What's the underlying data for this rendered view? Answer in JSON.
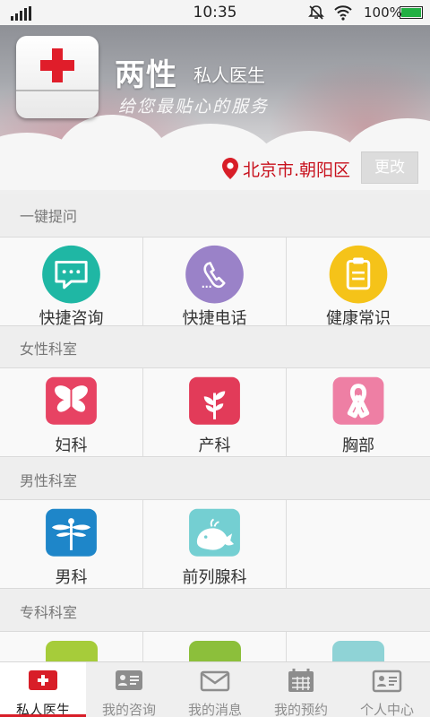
{
  "status_bar": {
    "time": "10:35",
    "battery": "100%",
    "icons": [
      "signal-icon",
      "mute-icon",
      "wifi-icon",
      "battery-icon"
    ]
  },
  "header": {
    "title": "两性",
    "subtitle": "私人医生",
    "slogan": "给您最贴心的服务",
    "location": "北京市.朝阳区",
    "change_label": "更改"
  },
  "sections": [
    {
      "title": "一键提问",
      "items": [
        {
          "label": "快捷咨询",
          "icon": "chat-bubble-icon",
          "color": "#1fb7a4"
        },
        {
          "label": "快捷电话",
          "icon": "phone-icon",
          "color": "#9a82c8"
        },
        {
          "label": "健康常识",
          "icon": "clipboard-icon",
          "color": "#f5c319"
        }
      ]
    },
    {
      "title": "女性科室",
      "items": [
        {
          "label": "妇科",
          "icon": "butterfly-icon",
          "color": "#e74363"
        },
        {
          "label": "产科",
          "icon": "sprout-icon",
          "color": "#e23b59"
        },
        {
          "label": "胸部",
          "icon": "pink-ribbon-icon",
          "color": "#ee7fa4"
        }
      ]
    },
    {
      "title": "男性科室",
      "items": [
        {
          "label": "男科",
          "icon": "dragonfly-icon",
          "color": "#1e86c9"
        },
        {
          "label": "前列腺科",
          "icon": "whale-icon",
          "color": "#74cfd2"
        }
      ]
    },
    {
      "title": "专科科室"
    }
  ],
  "tabs": [
    {
      "label": "私人医生",
      "icon": "medical-kit-icon",
      "active": true
    },
    {
      "label": "我的咨询",
      "icon": "contact-card-icon"
    },
    {
      "label": "我的消息",
      "icon": "envelope-icon"
    },
    {
      "label": "我的预约",
      "icon": "calendar-icon"
    },
    {
      "label": "个人中心",
      "icon": "id-card-icon"
    }
  ],
  "colors": {
    "brand_red": "#d81e28",
    "location_red": "#c8121e"
  }
}
